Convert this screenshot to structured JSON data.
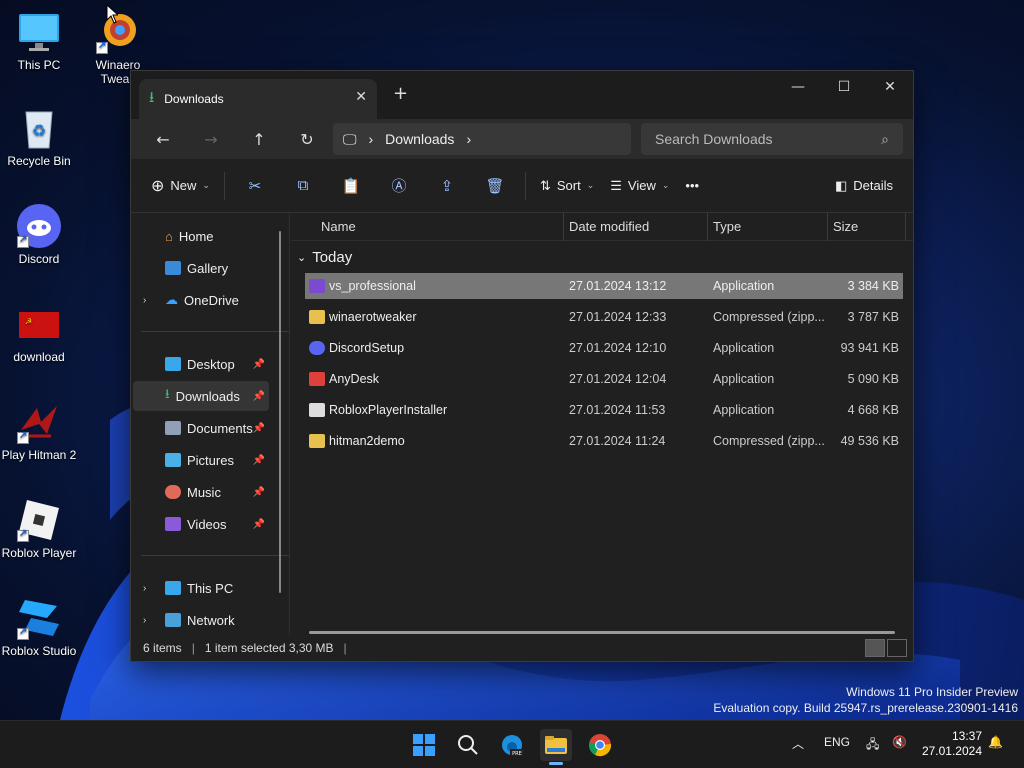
{
  "desktop": {
    "icons": [
      {
        "label": "This PC",
        "icon": "monitor-icon"
      },
      {
        "label": "Winaero Tweak",
        "icon": "winaero-icon"
      },
      {
        "label": "Recycle Bin",
        "icon": "recycle-bin-icon"
      },
      {
        "label": "Discord",
        "icon": "discord-icon"
      },
      {
        "label": "download",
        "icon": "flag-icon"
      },
      {
        "label": "Play Hitman 2",
        "icon": "hitman-icon"
      },
      {
        "label": "Roblox Player",
        "icon": "roblox-icon"
      },
      {
        "label": "Roblox Studio",
        "icon": "roblox-studio-icon"
      }
    ]
  },
  "window": {
    "tab_title": "Downloads",
    "new_tab": "+",
    "address": {
      "segment": "Downloads"
    },
    "search_placeholder": "Search Downloads",
    "toolbar": {
      "new_label": "New",
      "sort_label": "Sort",
      "view_label": "View",
      "details_label": "Details",
      "more": "•••"
    },
    "nav": {
      "home": "Home",
      "gallery": "Gallery",
      "onedrive": "OneDrive",
      "desktop": "Desktop",
      "downloads": "Downloads",
      "documents": "Documents",
      "pictures": "Pictures",
      "music": "Music",
      "videos": "Videos",
      "thispc": "This PC",
      "network": "Network"
    },
    "columns": {
      "name": "Name",
      "date": "Date modified",
      "type": "Type",
      "size": "Size"
    },
    "group": "Today",
    "files": [
      {
        "name": "vs_professional",
        "date": "27.01.2024 13:12",
        "type": "Application",
        "size": "3 384 KB"
      },
      {
        "name": "winaerotweaker",
        "date": "27.01.2024 12:33",
        "type": "Compressed (zipp...",
        "size": "3 787 KB"
      },
      {
        "name": "DiscordSetup",
        "date": "27.01.2024 12:10",
        "type": "Application",
        "size": "93 941 KB"
      },
      {
        "name": "AnyDesk",
        "date": "27.01.2024 12:04",
        "type": "Application",
        "size": "5 090 KB"
      },
      {
        "name": "RobloxPlayerInstaller",
        "date": "27.01.2024 11:53",
        "type": "Application",
        "size": "4 668 KB"
      },
      {
        "name": "hitman2demo",
        "date": "27.01.2024 11:24",
        "type": "Compressed (zipp...",
        "size": "49 536 KB"
      }
    ],
    "status": {
      "items": "6 items",
      "selected": "1 item selected  3,30 MB"
    }
  },
  "watermark": {
    "line1": "Windows 11 Pro Insider Preview",
    "line2": "Evaluation copy. Build 25947.rs_prerelease.230901-1416"
  },
  "taskbar": {
    "lang": "ENG",
    "time": "13:37",
    "date": "27.01.2024"
  },
  "colors": {
    "accent": "#6fb3ff",
    "selection": "#777777"
  }
}
